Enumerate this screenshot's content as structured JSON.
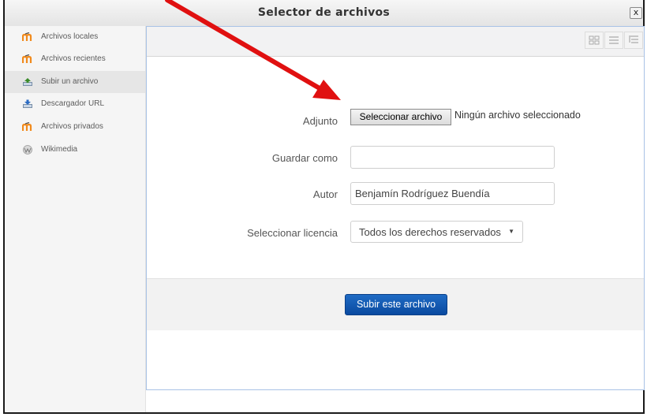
{
  "dialog": {
    "title": "Selector de archivos",
    "close_label": "x"
  },
  "sidebar": {
    "items": [
      {
        "label": "Archivos locales",
        "icon": "moodle-icon"
      },
      {
        "label": "Archivos recientes",
        "icon": "moodle-icon"
      },
      {
        "label": "Subir un archivo",
        "icon": "upload-icon",
        "active": true
      },
      {
        "label": "Descargador URL",
        "icon": "download-icon"
      },
      {
        "label": "Archivos privados",
        "icon": "moodle-icon"
      },
      {
        "label": "Wikimedia",
        "icon": "wikimedia-icon"
      }
    ]
  },
  "toolbar": {
    "views": [
      "icons-view-icon",
      "list-view-icon",
      "tree-view-icon"
    ]
  },
  "form": {
    "attachment_label": "Adjunto",
    "choose_file_button": "Seleccionar archivo",
    "no_file_text": "Ningún archivo seleccionado",
    "save_as_label": "Guardar como",
    "save_as_value": "",
    "author_label": "Autor",
    "author_value": "Benjamín Rodríguez Buendía",
    "license_label": "Seleccionar licencia",
    "license_value": "Todos los derechos reservados",
    "submit_button": "Subir este archivo"
  },
  "colors": {
    "accent": "#0a4aa0",
    "arrow": "#e01010",
    "moodle_orange": "#f18a1c"
  }
}
